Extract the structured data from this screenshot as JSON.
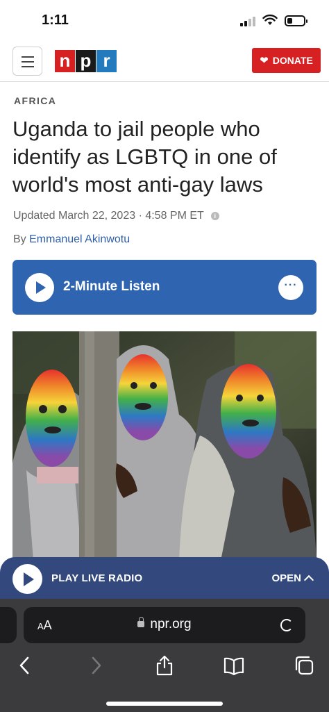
{
  "status_bar": {
    "time": "1:11",
    "battery_level": 0.3
  },
  "header": {
    "menu_icon": "hamburger-icon",
    "logo_letters": [
      "n",
      "p",
      "r"
    ],
    "donate_label": "DONATE",
    "donate_icon": "heart-icon",
    "brand_colors": {
      "red": "#d62021",
      "black": "#1a1a1a",
      "blue": "#237bbd"
    }
  },
  "article": {
    "section": "AFRICA",
    "headline": "Uganda to jail people who identify as LGBTQ in one of world's most anti-gay laws",
    "updated": "Updated March 22, 2023 · 4:58 PM ET",
    "byline_prefix": "By",
    "author": "Emmanuel Akinwotu",
    "listen_label": "2-Minute Listen",
    "listen_color": "#2e64b0"
  },
  "photo": {
    "icon": "photo-image"
  },
  "live_radio": {
    "label": "PLAY LIVE RADIO",
    "open_label": "OPEN",
    "color": "#33497d"
  },
  "browser": {
    "text_size_label": "AA",
    "url": "npr.org",
    "toolbar": [
      "back-icon",
      "forward-icon",
      "share-icon",
      "bookmarks-icon",
      "tabs-icon"
    ]
  }
}
